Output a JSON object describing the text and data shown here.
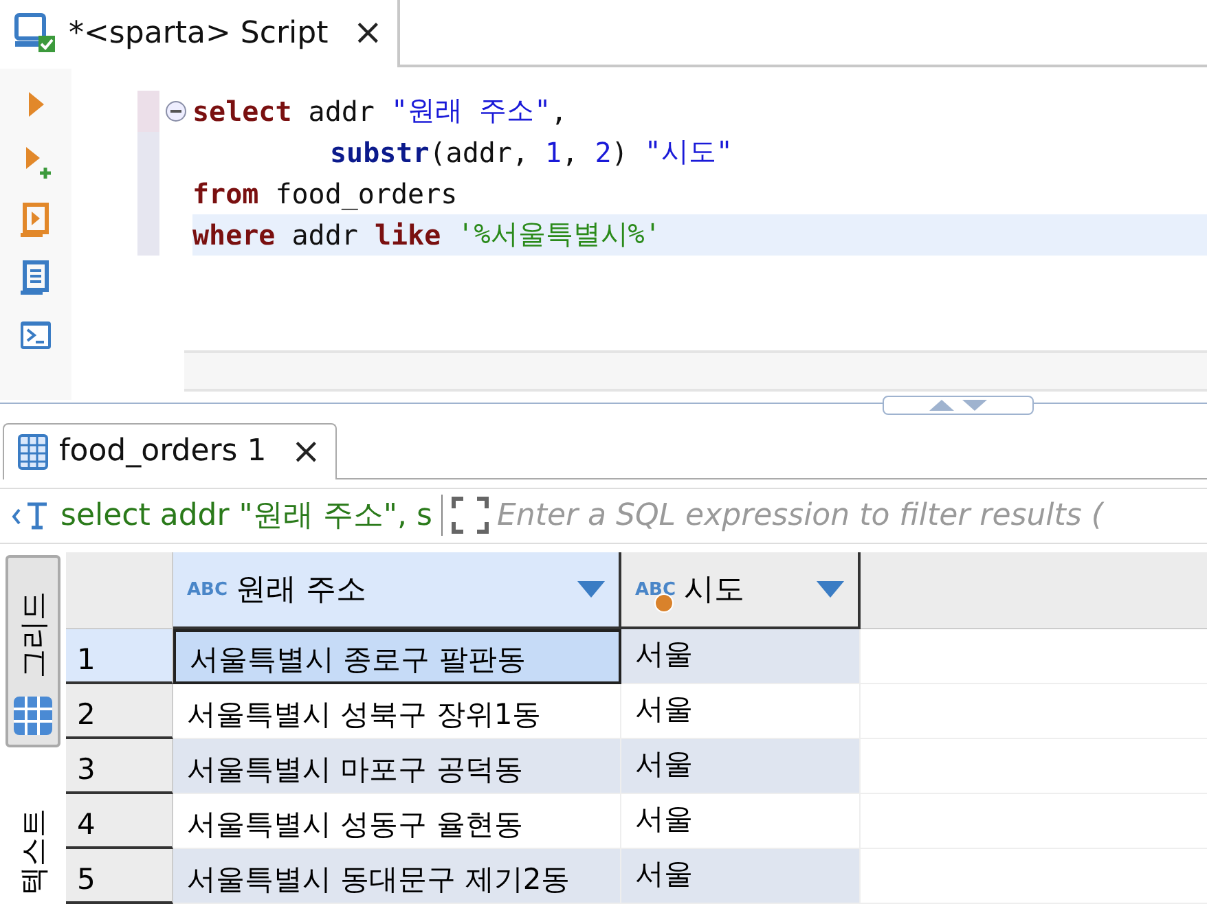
{
  "editor_tab": {
    "title": "*<sparta> Script",
    "close": "×",
    "selected": true
  },
  "code_lines": [
    {
      "current": false,
      "foldable": true,
      "indented": false,
      "tokens": [
        {
          "kind": "keyword",
          "text": "select"
        },
        {
          "kind": "plain",
          "text": " addr "
        },
        {
          "kind": "string",
          "text": "\"원래 주소\""
        },
        {
          "kind": "plain",
          "text": ","
        }
      ]
    },
    {
      "current": false,
      "foldable": false,
      "indented": true,
      "tokens": [
        {
          "kind": "function",
          "text": "substr"
        },
        {
          "kind": "plain",
          "text": "(addr, "
        },
        {
          "kind": "number",
          "text": "1"
        },
        {
          "kind": "plain",
          "text": ", "
        },
        {
          "kind": "number",
          "text": "2"
        },
        {
          "kind": "plain",
          "text": ") "
        },
        {
          "kind": "string",
          "text": "\"시도\""
        }
      ]
    },
    {
      "current": false,
      "foldable": false,
      "indented": false,
      "tokens": [
        {
          "kind": "keyword",
          "text": "from"
        },
        {
          "kind": "plain",
          "text": " food_orders"
        }
      ]
    },
    {
      "current": true,
      "foldable": false,
      "indented": false,
      "tokens": [
        {
          "kind": "keyword",
          "text": "where"
        },
        {
          "kind": "plain",
          "text": " addr "
        },
        {
          "kind": "keyword",
          "text": "like"
        },
        {
          "kind": "literal",
          "text": " '%서울특별시%'"
        }
      ]
    }
  ],
  "result_tab": {
    "title": "food_orders 1",
    "close": "×",
    "selected": true
  },
  "filter_bar": {
    "query": "select addr \"원래 주소\", s",
    "placeholder": "Enter a SQL expression to filter results ("
  },
  "view_tabs": [
    {
      "label": "그리드",
      "selected": true
    },
    {
      "label": "텍스트",
      "selected": false
    }
  ],
  "table": {
    "columns": [
      {
        "label": "원래 주소",
        "type": "ABC",
        "selected": true,
        "marked": false
      },
      {
        "label": "시도",
        "type": "ABC",
        "selected": false,
        "marked": true
      }
    ],
    "rows": [
      {
        "index": "1",
        "selected": true,
        "cells": [
          "서울특별시 종로구 팔판동",
          "서울"
        ]
      },
      {
        "index": "2",
        "selected": false,
        "cells": [
          "서울특별시 성북구 장위1동",
          "서울"
        ]
      },
      {
        "index": "3",
        "selected": false,
        "cells": [
          "서울특별시 마포구 공덕동",
          "서울"
        ]
      },
      {
        "index": "4",
        "selected": false,
        "cells": [
          "서울특별시 성동구 율현동",
          "서울"
        ]
      },
      {
        "index": "5",
        "selected": false,
        "cells": [
          "서울특별시 동대문구 제기2동",
          "서울"
        ]
      }
    ]
  }
}
